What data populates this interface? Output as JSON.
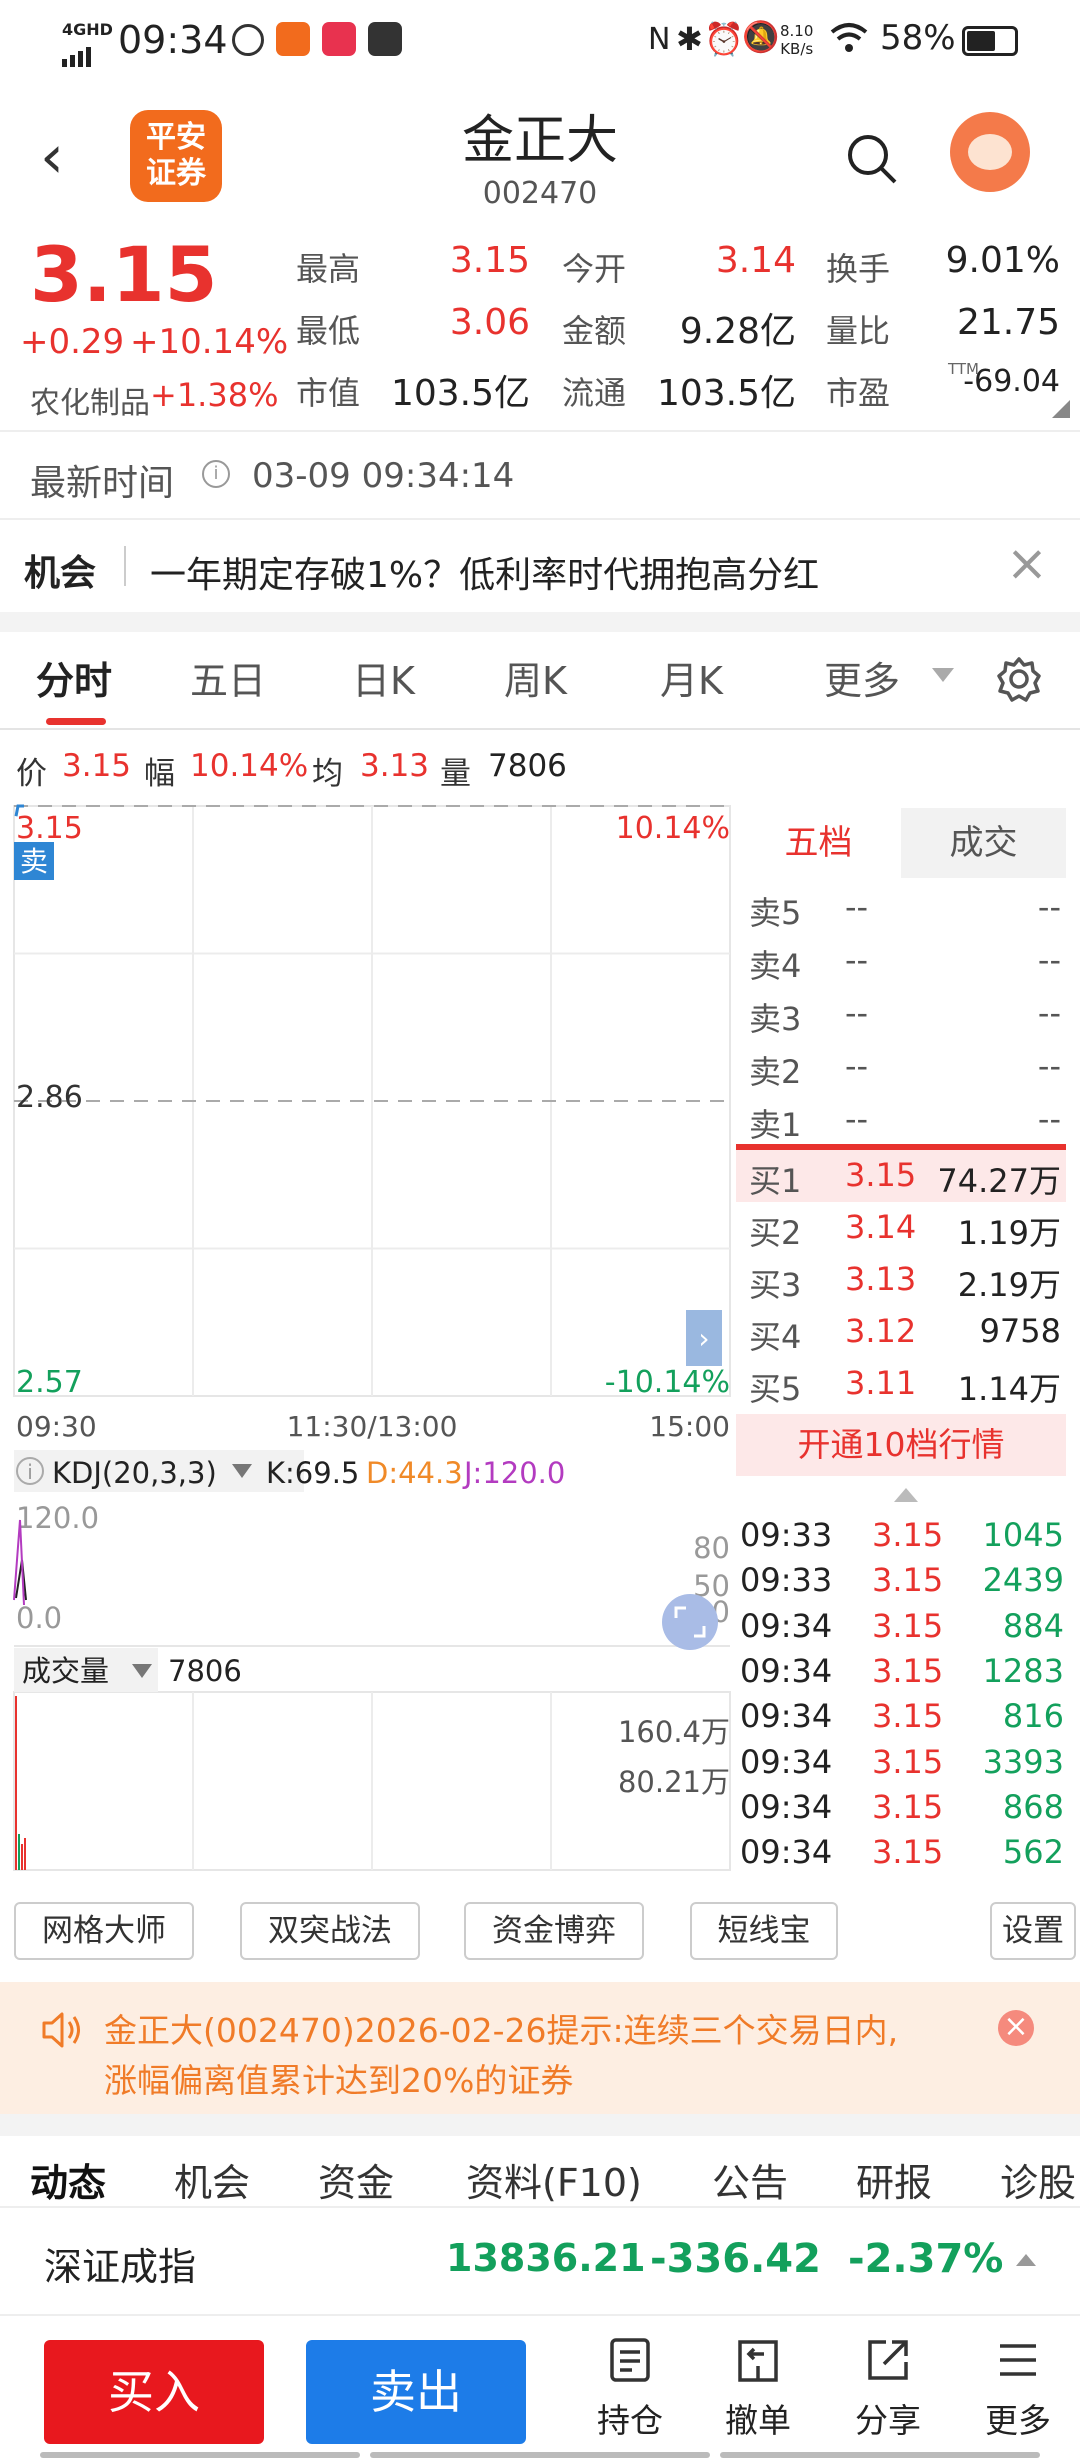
{
  "status_bar": {
    "network": "4GHD",
    "time": "09:34",
    "speed_value": "8.10",
    "speed_unit": "KB/s",
    "battery": "58%"
  },
  "header": {
    "logo_text_line1": "平安",
    "logo_text_line2": "证券",
    "stock_name": "金正大",
    "stock_code": "002470"
  },
  "quote": {
    "price": "3.15",
    "change": "+0.29",
    "change_pct": "+10.14%",
    "sector_name": "农化制品",
    "sector_change": "+1.38%",
    "stats": [
      {
        "label": "最高",
        "value": "3.15",
        "color": "red"
      },
      {
        "label": "今开",
        "value": "3.14",
        "color": "red"
      },
      {
        "label": "换手",
        "value": "9.01%",
        "color": "dark"
      },
      {
        "label": "最低",
        "value": "3.06",
        "color": "red"
      },
      {
        "label": "金额",
        "value": "9.28亿",
        "color": "dark"
      },
      {
        "label": "量比",
        "value": "21.75",
        "color": "dark"
      },
      {
        "label": "市值",
        "value": "103.5亿",
        "color": "dark"
      },
      {
        "label": "流通",
        "value": "103.5亿",
        "color": "dark"
      },
      {
        "label": "市盈",
        "value": "-69.04",
        "color": "dark"
      }
    ],
    "pe_tag": "TTM"
  },
  "update_time": {
    "label": "最新时间",
    "value": "03-09 09:34:14"
  },
  "opportunity": {
    "tag": "机会",
    "text": "一年期定存破1%？低利率时代拥抱高分红"
  },
  "chart_tabs": [
    "分时",
    "五日",
    "日K",
    "周K",
    "月K",
    "更多"
  ],
  "chart_info": {
    "price_label": "价",
    "price": "3.15",
    "range_label": "幅",
    "range": "10.14%",
    "avg_label": "均",
    "avg": "3.13",
    "vol_label": "量",
    "vol": "7806"
  },
  "chart_data": {
    "type": "line",
    "title": "",
    "y_ticks_left": [
      "3.15",
      "2.86",
      "2.57"
    ],
    "y_ticks_right": [
      "10.14%",
      "-10.14%"
    ],
    "x_ticks": [
      "09:30",
      "11:30/13:00",
      "15:00"
    ],
    "ylim": [
      2.57,
      3.15
    ],
    "sell_marker": "卖",
    "series": [
      {
        "values": [
          3.14,
          3.15,
          3.15,
          3.15,
          3.15
        ]
      }
    ]
  },
  "kdj": {
    "label": "KDJ(20,3,3)",
    "k": "K:69.5",
    "d": "D:44.3",
    "j": "J:120.0",
    "top": "120.0",
    "bottom": "0.0",
    "levels": [
      "80",
      "50",
      "20"
    ]
  },
  "volume": {
    "label": "成交量",
    "value": "7806",
    "ticks": [
      "160.4万",
      "80.21万"
    ]
  },
  "order_book": {
    "tab_active": "五档",
    "tab_inactive": "成交",
    "asks": [
      {
        "label": "卖5",
        "price": "--",
        "vol": "--"
      },
      {
        "label": "卖4",
        "price": "--",
        "vol": "--"
      },
      {
        "label": "卖3",
        "price": "--",
        "vol": "--"
      },
      {
        "label": "卖2",
        "price": "--",
        "vol": "--"
      },
      {
        "label": "卖1",
        "price": "--",
        "vol": "--"
      }
    ],
    "bids": [
      {
        "label": "买1",
        "price": "3.15",
        "vol": "74.27万"
      },
      {
        "label": "买2",
        "price": "3.14",
        "vol": "1.19万"
      },
      {
        "label": "买3",
        "price": "3.13",
        "vol": "2.19万"
      },
      {
        "label": "买4",
        "price": "3.12",
        "vol": "9758"
      },
      {
        "label": "买5",
        "price": "3.11",
        "vol": "1.14万"
      }
    ],
    "upgrade": "开通10档行情"
  },
  "trades": [
    {
      "time": "09:33",
      "price": "3.15",
      "vol": "1045"
    },
    {
      "time": "09:33",
      "price": "3.15",
      "vol": "2439"
    },
    {
      "time": "09:34",
      "price": "3.15",
      "vol": "884"
    },
    {
      "time": "09:34",
      "price": "3.15",
      "vol": "1283"
    },
    {
      "time": "09:34",
      "price": "3.15",
      "vol": "816"
    },
    {
      "time": "09:34",
      "price": "3.15",
      "vol": "3393"
    },
    {
      "time": "09:34",
      "price": "3.15",
      "vol": "868"
    },
    {
      "time": "09:34",
      "price": "3.15",
      "vol": "562"
    }
  ],
  "tools": [
    "网格大师",
    "双突战法",
    "资金博弈",
    "短线宝",
    "设置"
  ],
  "notice": {
    "line1": "金正大(002470)2026-02-26提示:连续三个交易日内,",
    "line2": "涨幅偏离值累计达到20%的证券"
  },
  "bottom_tabs": [
    "动态",
    "机会",
    "资金",
    "资料(F10)",
    "公告",
    "研报",
    "诊股"
  ],
  "index": {
    "name": "深证成指",
    "value": "13836.21",
    "change": "-336.42",
    "change_pct": "-2.37%"
  },
  "bottom_nav": {
    "buy": "买入",
    "sell": "卖出",
    "items": [
      {
        "icon": "holdings-icon",
        "label": "持仓"
      },
      {
        "icon": "cancel-order-icon",
        "label": "撤单"
      },
      {
        "icon": "share-icon",
        "label": "分享"
      },
      {
        "icon": "menu-icon",
        "label": "更多"
      }
    ]
  }
}
